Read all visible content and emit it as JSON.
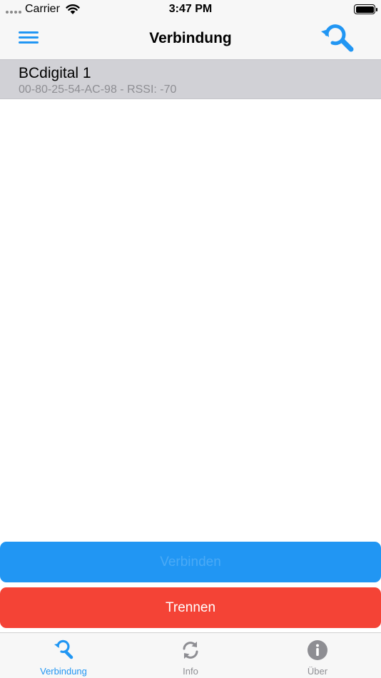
{
  "status_bar": {
    "carrier": "Carrier",
    "time": "3:47 PM"
  },
  "nav": {
    "title": "Verbindung",
    "menu_icon": "hamburger-menu-icon",
    "scan_icon": "refresh-search-icon"
  },
  "devices": [
    {
      "name": "BCdigital 1",
      "detail": "00-80-25-54-AC-98 - RSSI: -70"
    }
  ],
  "buttons": {
    "connect_label": "Verbinden",
    "disconnect_label": "Trennen"
  },
  "tabs": [
    {
      "label": "Verbindung",
      "icon": "search-icon",
      "active": true
    },
    {
      "label": "Info",
      "icon": "sync-icon",
      "active": false
    },
    {
      "label": "Über",
      "icon": "info-icon",
      "active": false
    }
  ],
  "colors": {
    "accent": "#2196f3",
    "danger": "#f44336",
    "selected_row": "#d1d1d6",
    "bar_background": "#f7f7f7",
    "inactive": "#8e8e93"
  }
}
